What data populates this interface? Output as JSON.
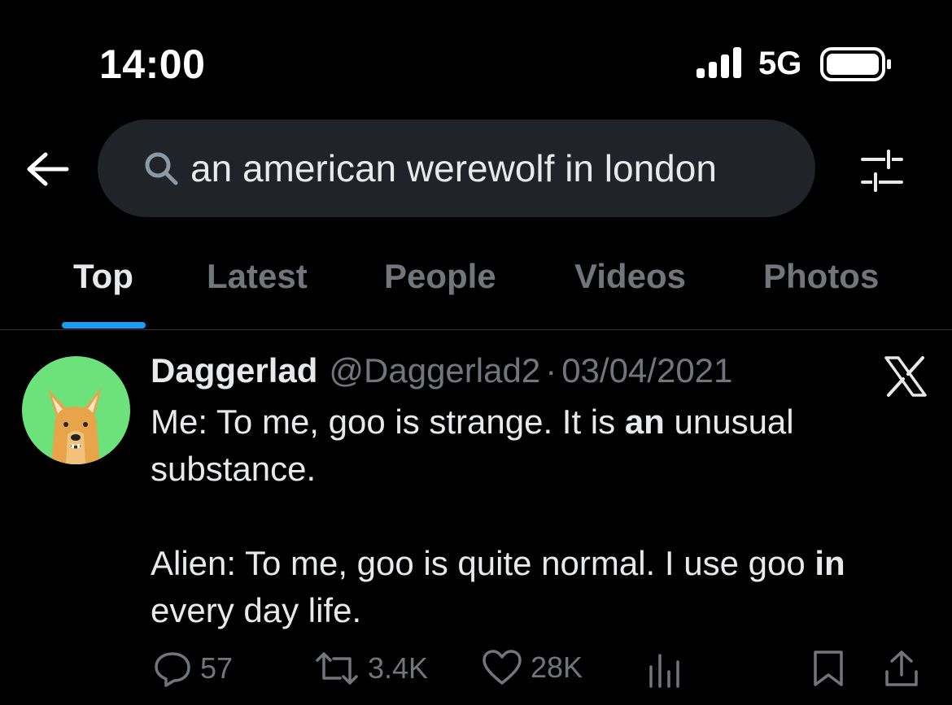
{
  "status_bar": {
    "time": "14:00",
    "network": "5G",
    "signal_icon": "cellular-signal-icon",
    "battery_icon": "battery-icon"
  },
  "search": {
    "query": "an american werewolf in london",
    "icons": {
      "back": "arrow-left-icon",
      "search": "magnifier-icon",
      "filter": "sliders-icon"
    }
  },
  "tabs": [
    {
      "label": "Top",
      "active": true
    },
    {
      "label": "Latest",
      "active": false
    },
    {
      "label": "People",
      "active": false
    },
    {
      "label": "Videos",
      "active": false
    },
    {
      "label": "Photos",
      "active": false
    }
  ],
  "tweet": {
    "display_name": "Daggerlad",
    "handle": "@Daggerlad2",
    "separator": "·",
    "date": "03/04/2021",
    "platform_icon": "x-logo-icon",
    "avatar_icon": "dog-avatar-icon",
    "body": {
      "line1_pre": "Me: To me, goo is strange. It is ",
      "line1_bold": "an",
      "line1_post": " unusual substance.",
      "line2_pre": "Alien: To me, goo is quite normal. I use goo ",
      "line2_bold": "in",
      "line2_post": " every day life."
    },
    "actions": {
      "replies": "57",
      "reposts": "3.4K",
      "likes": "28K",
      "icons": [
        "reply-icon",
        "repost-icon",
        "like-icon",
        "views-icon",
        "bookmark-icon",
        "share-icon"
      ]
    }
  },
  "colors": {
    "background": "#000000",
    "search_pill": "#202327",
    "primary_text": "#e7e9ea",
    "secondary_text": "#71767b",
    "accent": "#1d9bf0",
    "avatar_bg": "#6ee27a"
  }
}
